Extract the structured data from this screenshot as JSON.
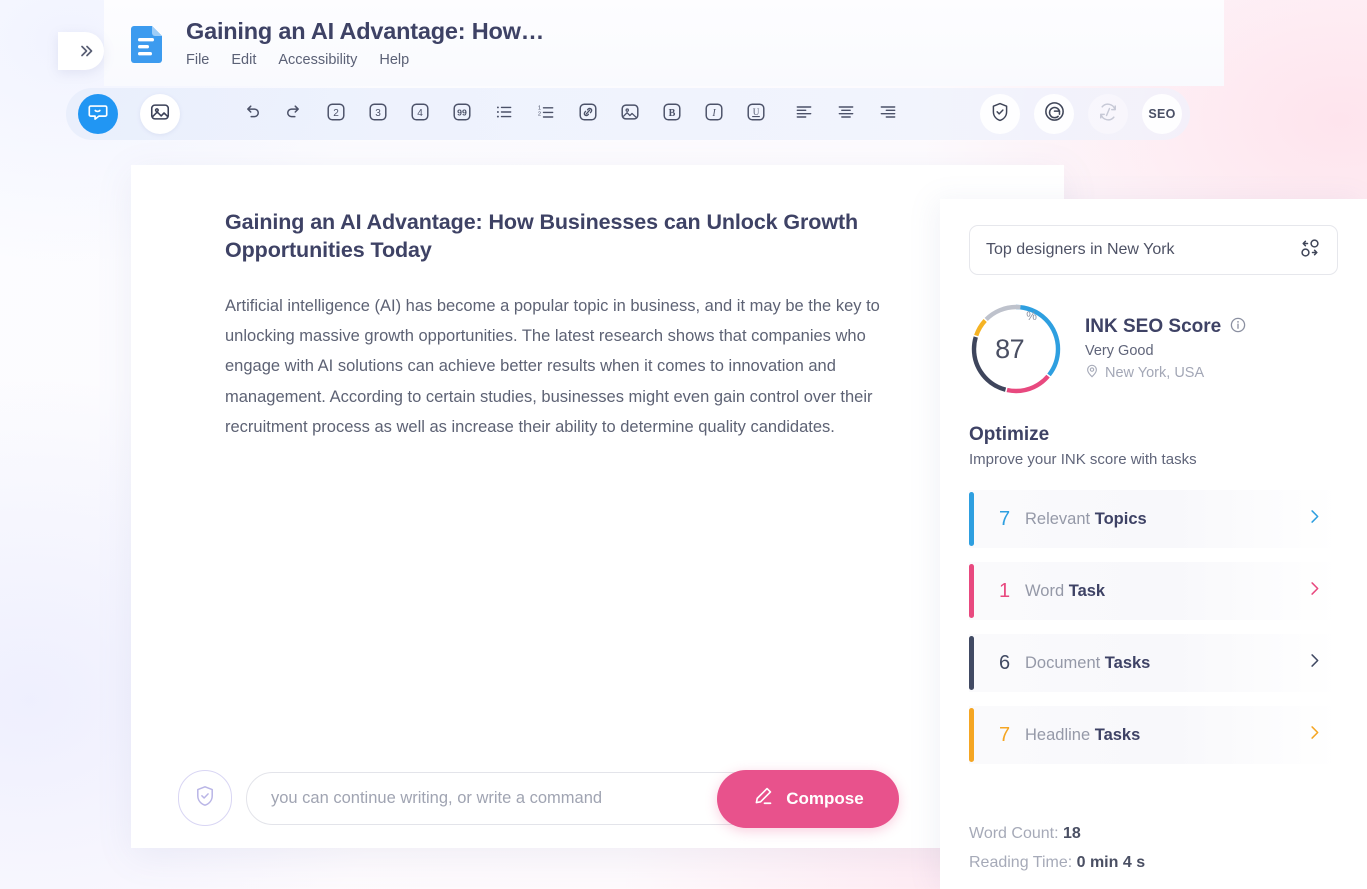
{
  "window": {
    "title": "Gaining an AI Advantage: How…"
  },
  "rail": {
    "expand_icon": "chevrons-right-icon"
  },
  "menubar": {
    "items": [
      "File",
      "Edit",
      "Accessibility",
      "Help"
    ]
  },
  "toolbar": {
    "mode_buttons": [
      {
        "name": "assistant-mode",
        "icon": "chat-smile-icon",
        "active": true
      },
      {
        "name": "image-mode",
        "icon": "image-icon",
        "active": false
      }
    ],
    "format_buttons": [
      {
        "name": "undo",
        "icon": "undo-icon",
        "label": ""
      },
      {
        "name": "redo",
        "icon": "redo-icon",
        "label": ""
      },
      {
        "name": "heading-2",
        "icon": "heading-2-icon",
        "label": "2"
      },
      {
        "name": "heading-3",
        "icon": "heading-3-icon",
        "label": "3"
      },
      {
        "name": "heading-4",
        "icon": "heading-4-icon",
        "label": "4"
      },
      {
        "name": "blockquote",
        "icon": "quote-icon",
        "label": "99"
      },
      {
        "name": "bullet-list",
        "icon": "bullet-list-icon",
        "label": ""
      },
      {
        "name": "numbered-list",
        "icon": "numbered-list-icon",
        "label": ""
      },
      {
        "name": "insert-link",
        "icon": "link-icon",
        "label": ""
      },
      {
        "name": "insert-image",
        "icon": "image-icon",
        "label": ""
      },
      {
        "name": "bold",
        "icon": "bold-icon",
        "label": "B"
      },
      {
        "name": "italic",
        "icon": "italic-icon",
        "label": "I"
      },
      {
        "name": "underline",
        "icon": "underline-icon",
        "label": "U"
      },
      {
        "name": "align-left",
        "icon": "align-left-icon",
        "label": ""
      },
      {
        "name": "align-center",
        "icon": "align-center-icon",
        "label": ""
      },
      {
        "name": "align-justify",
        "icon": "align-justify-icon",
        "label": ""
      }
    ],
    "right_buttons": [
      {
        "name": "content-shield",
        "icon": "shield-check-icon",
        "label": ""
      },
      {
        "name": "grammar-check",
        "icon": "grammarly-g-icon",
        "label": ""
      },
      {
        "name": "plagiarism-check",
        "icon": "plagiarism-icon",
        "label": ""
      },
      {
        "name": "seo-toggle",
        "icon": "seo-text-icon",
        "label": "SEO"
      }
    ]
  },
  "document": {
    "heading": "Gaining an AI Advantage: How Businesses can Unlock Growth Opportunities Today",
    "paragraph": "Artificial intelligence (AI) has become a popular topic in business, and it may be the key to unlocking massive growth opportunities. The latest research shows that companies who engage with AI solutions can achieve better results when it comes to innovation and management. According to certain studies, businesses might even gain control over their recruitment process as well as increase their ability to determine quality candidates."
  },
  "compose": {
    "shield_icon": "shield-check-icon",
    "placeholder": "you can continue writing, or write a command",
    "value": "",
    "button_label": "Compose",
    "button_icon": "pencil-icon",
    "button_color": "#E8528C"
  },
  "seo_panel": {
    "keyword": {
      "value": "Top designers in New York",
      "swap_icon": "swap-keyword-icon"
    },
    "score": {
      "value": "87",
      "unit": "%",
      "title": "INK SEO Score",
      "info_icon": "info-icon",
      "rating": "Very Good",
      "location": "New York, USA",
      "location_icon": "map-pin-icon",
      "ring_segments": [
        {
          "name": "blue",
          "color": "#2E9FE0",
          "degrees": 128
        },
        {
          "name": "pink",
          "color": "#E8497F",
          "degrees": 62
        },
        {
          "name": "navy",
          "color": "#3E455C",
          "degrees": 92
        },
        {
          "name": "amber",
          "color": "#F5B324",
          "degrees": 24
        },
        {
          "name": "grey",
          "color": "#BEC2CC",
          "degrees": 54
        }
      ]
    },
    "optimize": {
      "title": "Optimize",
      "subtitle": "Improve your INK score with tasks",
      "tasks": [
        {
          "count": "7",
          "prefix": "Relevant ",
          "bold": "Topics",
          "color": "#2E9FE0",
          "chevron_icon": "chevron-right-icon"
        },
        {
          "count": "1",
          "prefix": "Word ",
          "bold": "Task",
          "color": "#E8497F",
          "chevron_icon": "chevron-right-icon"
        },
        {
          "count": "6",
          "prefix": "Document ",
          "bold": "Tasks",
          "color": "#414A63",
          "chevron_icon": "chevron-right-icon"
        },
        {
          "count": "7",
          "prefix": "Headline ",
          "bold": "Tasks",
          "color": "#F5A623",
          "chevron_icon": "chevron-right-icon"
        }
      ]
    },
    "stats": {
      "word_count_label": "Word Count: ",
      "word_count_value": "18",
      "reading_time_label": "Reading Time: ",
      "reading_time_value": "0 min 4 s"
    }
  }
}
